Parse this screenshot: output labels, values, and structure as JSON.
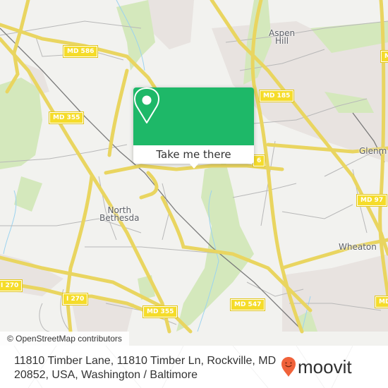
{
  "map": {
    "colors": {
      "background": "#f2f2ef",
      "park": "#d4e8bc",
      "urban": "#e8e3e0",
      "road_major": "#f5e46a",
      "road_minor": "#b8b8b8",
      "railway": "#808080",
      "water": "#9cd3ef"
    },
    "road_shields": [
      {
        "label": "MD 586"
      },
      {
        "label": "MD 355"
      },
      {
        "label": "MD 185"
      },
      {
        "label": "MD 97"
      },
      {
        "label": "I 270"
      },
      {
        "label": "I 270"
      },
      {
        "label": "MD 355"
      },
      {
        "label": "MD 547"
      },
      {
        "label": "MD"
      },
      {
        "label": "M"
      },
      {
        "label": "6"
      }
    ],
    "places": [
      {
        "label_line1": "Aspen",
        "label_line2": "Hill"
      },
      {
        "label_line1": "North",
        "label_line2": "Bethesda"
      },
      {
        "label_line1": "Wheaton"
      },
      {
        "label_line1": "Glenm"
      }
    ],
    "attribution": "© OpenStreetMap contributors"
  },
  "popup": {
    "icon": "map-pin-icon",
    "button_label": "Take me there",
    "color": "#1eb868"
  },
  "footer": {
    "address": "11810 Timber Lane, 11810 Timber Ln, Rockville, MD 20852, USA, Washington / Baltimore",
    "logo": {
      "text": "moovit",
      "icon": "moovit-pin-icon",
      "color": "#f0623a"
    }
  }
}
